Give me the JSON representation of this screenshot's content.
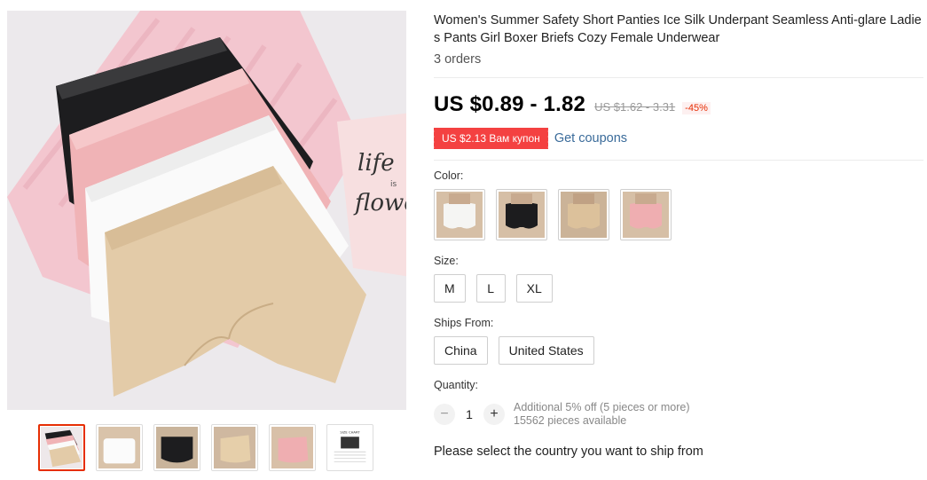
{
  "product": {
    "title": "Women's Summer Safety Short Panties Ice Silk Underpant Seamless Anti-glare Ladies Pants Girl Boxer Briefs Cozy Female Underwear",
    "orders": "3 orders"
  },
  "price": {
    "current": "US $0.89 - 1.82",
    "original": "US $1.62 - 3.31",
    "discount": "-45%"
  },
  "coupon": {
    "tag": "US $2.13 Вам купон",
    "link": "Get coupons"
  },
  "color": {
    "label": "Color:",
    "options": [
      {
        "name": "white",
        "swatch": "#f5f5f3"
      },
      {
        "name": "black",
        "swatch": "#1c1c1e"
      },
      {
        "name": "nude",
        "swatch": "#d8bc96"
      },
      {
        "name": "pink",
        "swatch": "#efaeb1"
      }
    ]
  },
  "size": {
    "label": "Size:",
    "options": [
      "M",
      "L",
      "XL"
    ]
  },
  "ships_from": {
    "label": "Ships From:",
    "options": [
      "China",
      "United States"
    ]
  },
  "quantity": {
    "label": "Quantity:",
    "minus": "−",
    "plus": "+",
    "value": "1",
    "note": "Additional 5% off (5 pieces or more)",
    "available": "15562 pieces available"
  },
  "shipping_note": "Please select the country you want to ship from",
  "gallery": {
    "card_text_1": "life",
    "card_text_2": "is",
    "card_text_3": "flowe",
    "thumb_chart_label": "SIZE CHART"
  },
  "colors": {
    "accent": "#e62e04",
    "coupon_bg": "#f44141",
    "link": "#3a6b9a"
  }
}
